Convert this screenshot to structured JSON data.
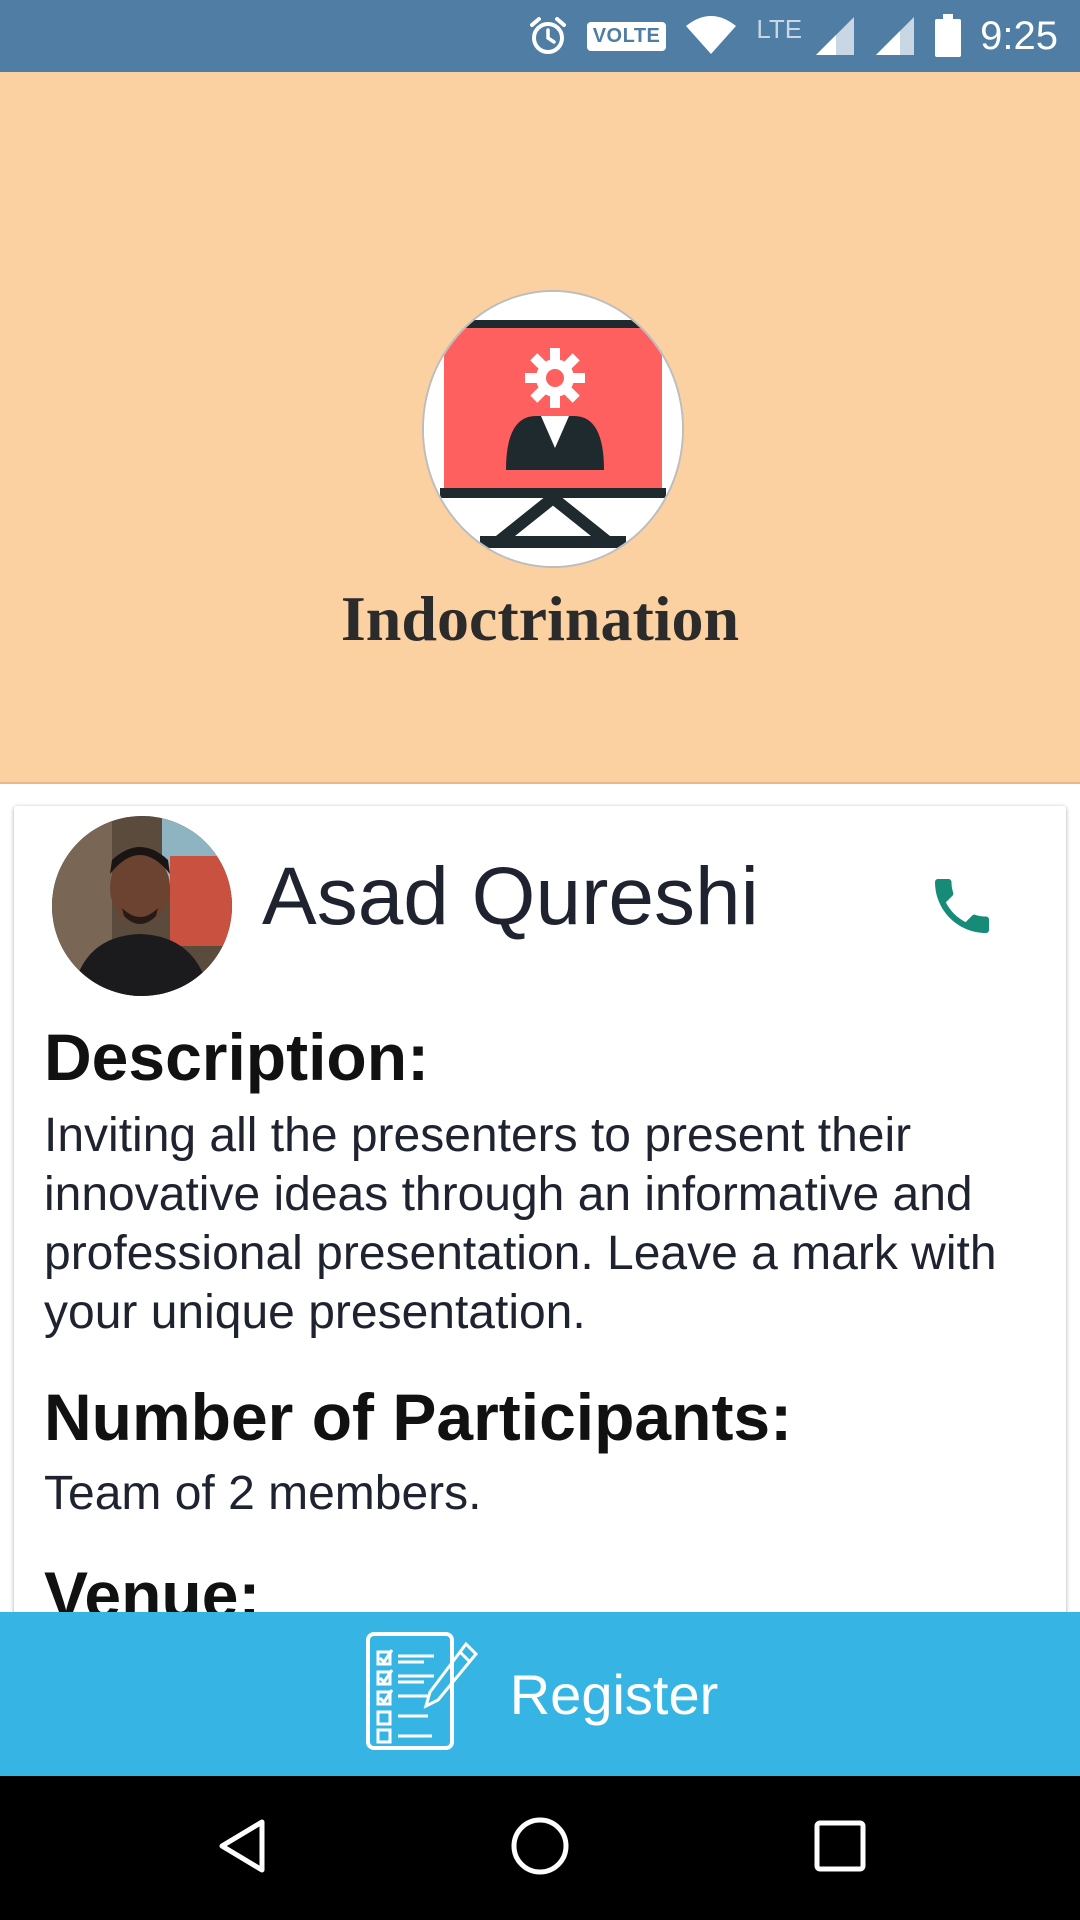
{
  "status_bar": {
    "time": "9:25",
    "volte_label": "VOLTE",
    "lte_label": "LTE",
    "icons": [
      "alarm-icon",
      "volte-icon",
      "wifi-icon",
      "lte-signal-icon",
      "signal-icon",
      "battery-icon"
    ]
  },
  "banner": {
    "event_title": "Indoctrination",
    "background_color": "#fcd1a1",
    "logo_icon": "presentation-board-icon",
    "logo_color": "#fe5f5f"
  },
  "organizer": {
    "name": "Asad Qureshi",
    "call_icon": "phone-icon",
    "call_color": "#168c78"
  },
  "details": {
    "description_heading": "Description:",
    "description_text": "Inviting all the presenters to present their innovative ideas through an  informative and professional presentation. Leave a mark with your unique presentation.",
    "participants_heading": "Number of Participants:",
    "participants_text": "Team of 2 members.",
    "venue_heading": "Venue:"
  },
  "register": {
    "label": "Register",
    "icon": "checklist-pencil-icon",
    "background_color": "#36b5e4"
  },
  "nav_bar": {
    "buttons": [
      "back-icon",
      "home-icon",
      "recents-icon"
    ]
  }
}
